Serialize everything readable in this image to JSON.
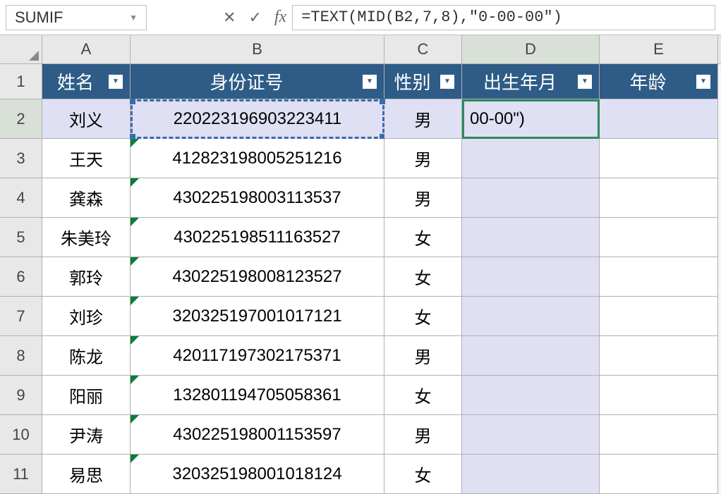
{
  "name_box": "SUMIF",
  "formula": "=TEXT(MID(B2,7,8),\"0-00-00\")",
  "columns": [
    "A",
    "B",
    "C",
    "D",
    "E"
  ],
  "headers": {
    "name": "姓名",
    "id": "身份证号",
    "gender": "性别",
    "dob": "出生年月",
    "age": "年龄"
  },
  "active_cell_display": "00-00\")",
  "rows": [
    {
      "num": "1"
    },
    {
      "num": "2",
      "name": "刘义",
      "id": "220223196903223411",
      "gender": "男"
    },
    {
      "num": "3",
      "name": "王天",
      "id": "412823198005251216",
      "gender": "男"
    },
    {
      "num": "4",
      "name": "龚森",
      "id": "430225198003113537",
      "gender": "男"
    },
    {
      "num": "5",
      "name": "朱美玲",
      "id": "430225198511163527",
      "gender": "女"
    },
    {
      "num": "6",
      "name": "郭玲",
      "id": "430225198008123527",
      "gender": "女"
    },
    {
      "num": "7",
      "name": "刘珍",
      "id": "320325197001017121",
      "gender": "女"
    },
    {
      "num": "8",
      "name": "陈龙",
      "id": "420117197302175371",
      "gender": "男"
    },
    {
      "num": "9",
      "name": "阳丽",
      "id": "132801194705058361",
      "gender": "女"
    },
    {
      "num": "10",
      "name": "尹涛",
      "id": "430225198001153597",
      "gender": "男"
    },
    {
      "num": "11",
      "name": "易思",
      "id": "320325198001018124",
      "gender": "女"
    }
  ]
}
